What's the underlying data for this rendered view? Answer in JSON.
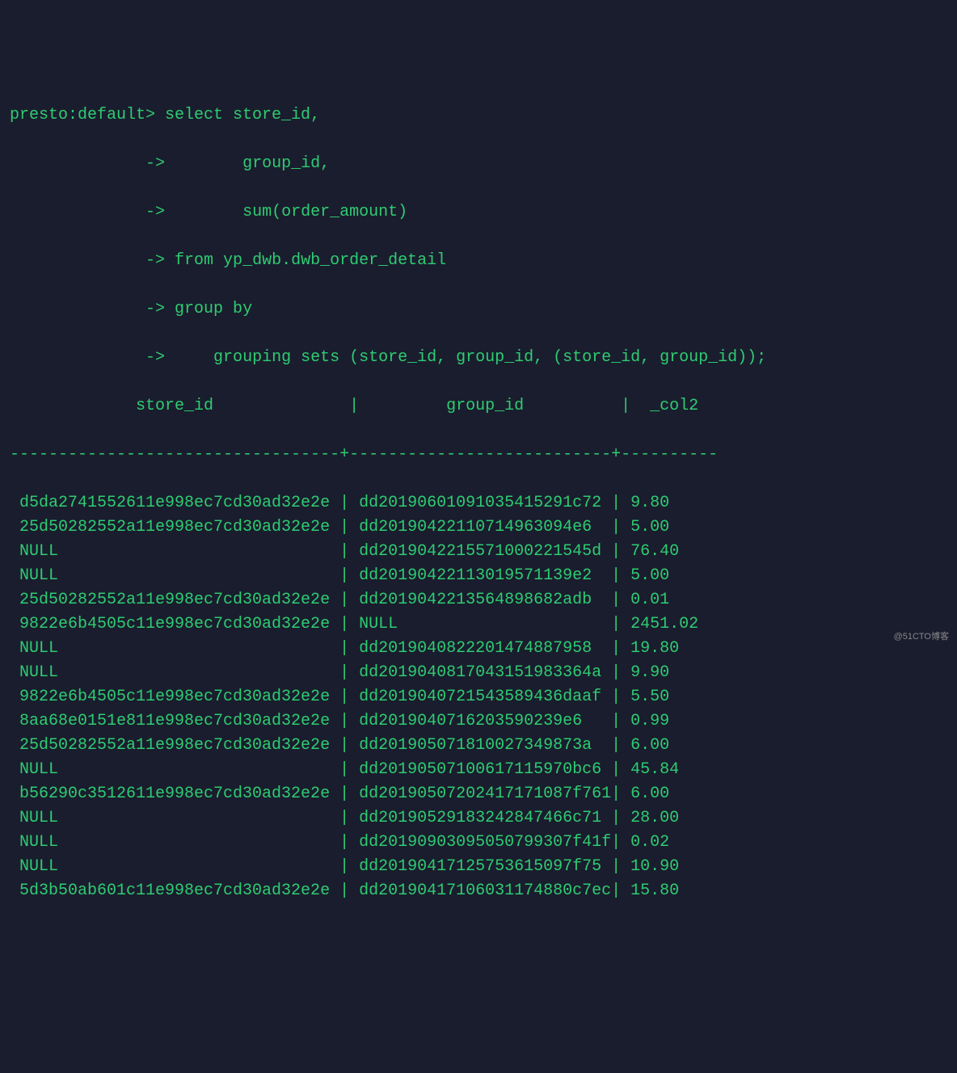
{
  "prompt": "presto:default>",
  "continuation": "->",
  "query": {
    "line1": " select store_id,",
    "line2": "        group_id,",
    "line3": "        sum(order_amount)",
    "line4": " from yp_dwb.dwb_order_detail",
    "line5": " group by",
    "line6": "     grouping sets (store_id, group_id, (store_id, group_id));"
  },
  "header": {
    "col1": "store_id",
    "col2": "group_id",
    "col3": "_col2"
  },
  "separator": "----------------------------------+---------------------------+----------",
  "rows": [
    {
      "c1": "d5da2741552611e998ec7cd30ad32e2e",
      "c2": "dd20190601091035415291c72",
      "c3": "9.80"
    },
    {
      "c1": "25d50282552a11e998ec7cd30ad32e2e",
      "c2": "dd20190422110714963094e6",
      "c3": "5.00"
    },
    {
      "c1": "NULL",
      "c2": "dd2019042215571000221545d",
      "c3": "76.40"
    },
    {
      "c1": "NULL",
      "c2": "dd20190422113019571139e2",
      "c3": "5.00"
    },
    {
      "c1": "25d50282552a11e998ec7cd30ad32e2e",
      "c2": "dd2019042213564898682adb",
      "c3": "0.01"
    },
    {
      "c1": "9822e6b4505c11e998ec7cd30ad32e2e",
      "c2": "NULL",
      "c3": "2451.02"
    },
    {
      "c1": "NULL",
      "c2": "dd2019040822201474887958",
      "c3": "19.80"
    },
    {
      "c1": "NULL",
      "c2": "dd2019040817043151983364a",
      "c3": "9.90"
    },
    {
      "c1": "9822e6b4505c11e998ec7cd30ad32e2e",
      "c2": "dd2019040721543589436daaf",
      "c3": "5.50"
    },
    {
      "c1": "8aa68e0151e811e998ec7cd30ad32e2e",
      "c2": "dd2019040716203590239e6",
      "c3": "0.99"
    },
    {
      "c1": "25d50282552a11e998ec7cd30ad32e2e",
      "c2": "dd201905071810027349873a",
      "c3": "6.00"
    },
    {
      "c1": "NULL",
      "c2": "dd20190507100617115970bc6",
      "c3": "45.84"
    },
    {
      "c1": "b56290c3512611e998ec7cd30ad32e2e",
      "c2": "dd20190507202417171087f761",
      "c3": "6.00"
    },
    {
      "c1": "NULL",
      "c2": "dd20190529183242847466c71",
      "c3": "28.00"
    },
    {
      "c1": "NULL",
      "c2": "dd20190903095050799307f41f",
      "c3": "0.02"
    },
    {
      "c1": "NULL",
      "c2": "dd20190417125753615097f75",
      "c3": "10.90"
    },
    {
      "c1": "5d3b50ab601c11e998ec7cd30ad32e2e",
      "c2": "dd20190417106031174880c7ec",
      "c3": "15.80"
    }
  ],
  "watermark": "@51CTO博客"
}
